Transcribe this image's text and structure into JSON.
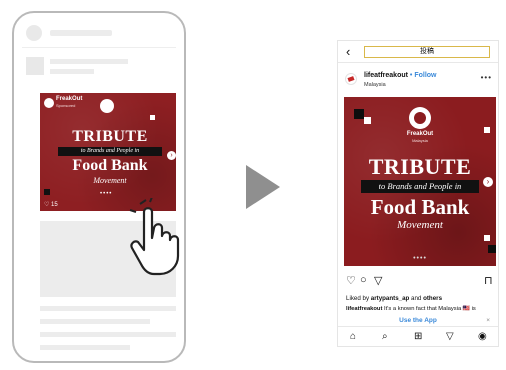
{
  "mini_post": {
    "account": "FreakOut",
    "account_sub": "Sponsored",
    "title_line1": "TRIBUTE",
    "band_text": "to Brands and People in",
    "title_line2": "Food Bank",
    "title_line3": "Movement",
    "likes": "♡ 15",
    "dots": "••••"
  },
  "post": {
    "header_title": "投稿",
    "username": "lifeatfreakout",
    "follow_label": "• Follow",
    "location": "Malaysia",
    "more": "•••",
    "brand": "FreakOut",
    "brand_sub": "Malaysia",
    "title_line1": "TRIBUTE",
    "band_text": "to Brands and People in",
    "title_line2": "Food Bank",
    "title_line3": "Movement",
    "dots": "••••",
    "liked_by_prefix": "Liked by",
    "liked_by_user": "artypants_ap",
    "liked_by_and": "and",
    "liked_by_others": "others",
    "caption_user": "lifeatfreakout",
    "caption_text": " It's a known fact that Malaysia 🇲🇾 is",
    "use_app": "Use the App",
    "close": "×"
  },
  "icons": {
    "back": "back-chevron-icon",
    "heart": "heart-icon",
    "comment": "comment-icon",
    "share": "send-icon",
    "bookmark": "bookmark-icon",
    "home": "home-icon",
    "search": "search-icon",
    "add": "add-post-icon",
    "activity": "send-icon",
    "profile": "profile-icon",
    "tap": "tap-hand-icon",
    "arrow": "play-arrow-icon"
  },
  "colors": {
    "post_red": "#8b1c1f",
    "link_blue": "#3a89d9",
    "title_box_border": "#d9b84a",
    "arrow_gray": "#8f8f8f"
  }
}
